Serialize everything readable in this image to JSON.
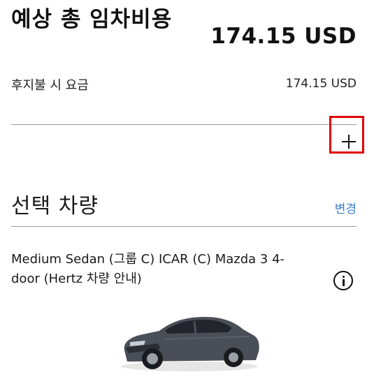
{
  "summary": {
    "total_label": "예상 총 임차비용",
    "total_amount": "174.15 USD",
    "pay_later_label": "후지불 시 요금",
    "pay_later_amount": "174.15 USD"
  },
  "vehicle": {
    "section_title": "선택 차량",
    "change_label": "변경",
    "description": "Medium Sedan (그룹 C) ICAR (C) Mazda 3 4-door (Hertz 차량 안내)",
    "car_color": "#4a4e57"
  },
  "colors": {
    "link": "#3a7bc8",
    "highlight": "#e00000"
  }
}
